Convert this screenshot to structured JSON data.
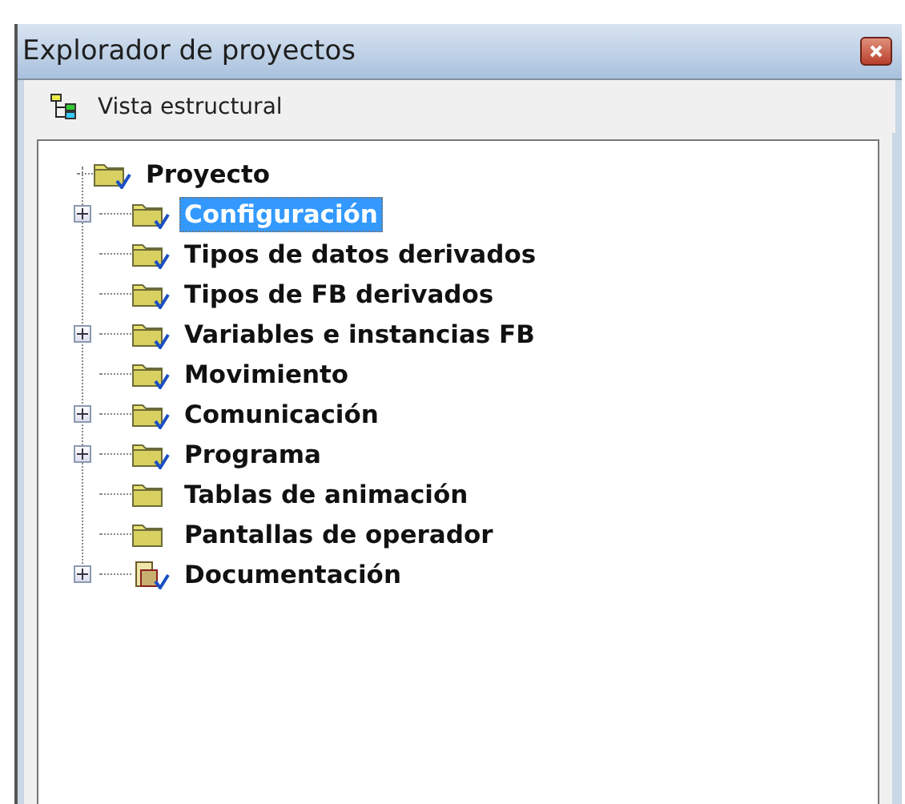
{
  "window": {
    "title": "Explorador de proyectos"
  },
  "toolbar": {
    "label": "Vista estructural"
  },
  "tree": {
    "label": "Proyecto",
    "kind": "folder-check",
    "children": [
      {
        "label": "Configuración",
        "kind": "folder-check",
        "expander": true,
        "selected": true
      },
      {
        "label": "Tipos de datos derivados",
        "kind": "folder-check",
        "expander": false,
        "selected": false
      },
      {
        "label": "Tipos de FB derivados",
        "kind": "folder-check",
        "expander": false,
        "selected": false
      },
      {
        "label": "Variables e instancias FB",
        "kind": "folder-check",
        "expander": true,
        "selected": false
      },
      {
        "label": "Movimiento",
        "kind": "folder-check",
        "expander": false,
        "selected": false
      },
      {
        "label": "Comunicación",
        "kind": "folder-check",
        "expander": true,
        "selected": false
      },
      {
        "label": "Programa",
        "kind": "folder-check",
        "expander": true,
        "selected": false
      },
      {
        "label": "Tablas de animación",
        "kind": "folder",
        "expander": false,
        "selected": false
      },
      {
        "label": "Pantallas de operador",
        "kind": "folder",
        "expander": false,
        "selected": false
      },
      {
        "label": "Documentación",
        "kind": "document",
        "expander": true,
        "selected": false
      }
    ]
  }
}
